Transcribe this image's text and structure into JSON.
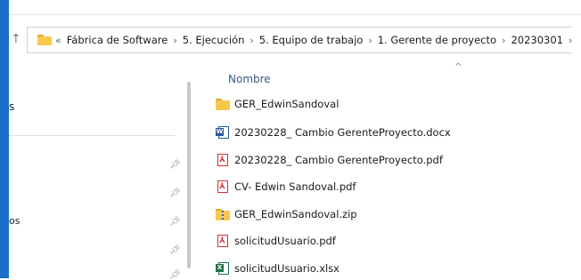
{
  "address": {
    "overflow": "«",
    "crumbs": [
      "Fábrica de Software",
      "5. Ejecución",
      "5. Equipo de trabajo",
      "1. Gerente de proyecto",
      "20230301"
    ],
    "separator": "›"
  },
  "nav": {
    "partial_labels": [
      "s",
      "os"
    ]
  },
  "file_list": {
    "column_header": "Nombre",
    "sort_indicator": "^",
    "items": [
      {
        "name": "GER_EdwinSandoval",
        "type": "folder"
      },
      {
        "name": "20230228_ Cambio GerenteProyecto.docx",
        "type": "word"
      },
      {
        "name": "20230228_ Cambio GerenteProyecto.pdf",
        "type": "pdf"
      },
      {
        "name": "CV- Edwin Sandoval.pdf",
        "type": "pdf"
      },
      {
        "name": "GER_EdwinSandoval.zip",
        "type": "zip"
      },
      {
        "name": "solicitudUsuario.pdf",
        "type": "pdf"
      },
      {
        "name": "solicitudUsuario.xlsx",
        "type": "excel"
      }
    ]
  },
  "colors": {
    "accent": "#1b6fc7",
    "folder": "#f8c84a",
    "word": "#2b579a",
    "pdf": "#d32f2f",
    "excel": "#217346"
  }
}
